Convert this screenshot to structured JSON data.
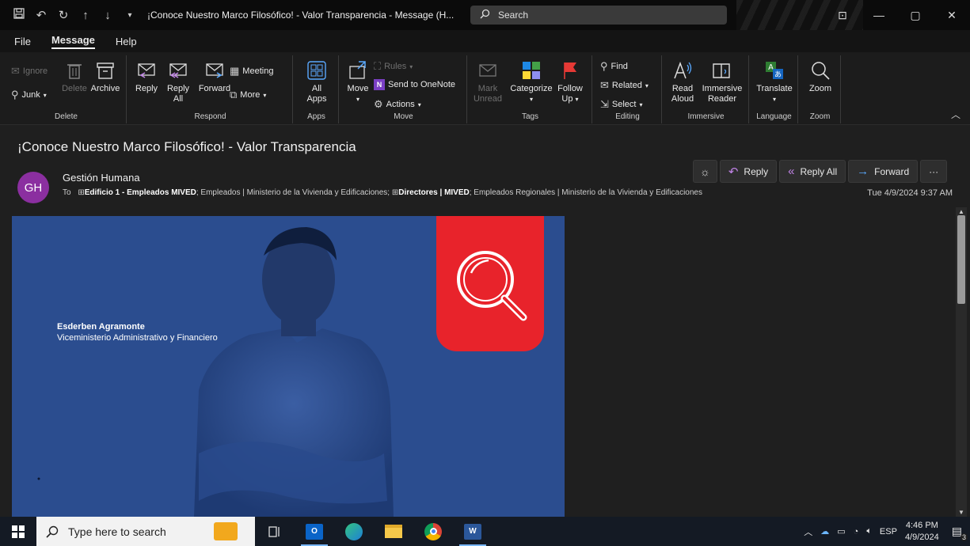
{
  "titlebar": {
    "title": "¡Conoce Nuestro Marco Filosófico! - Valor Transparencia  -  Message (H...",
    "search_placeholder": "Search"
  },
  "menu": {
    "tabs": [
      "File",
      "Message",
      "Help"
    ],
    "active": "Message"
  },
  "ribbon": {
    "delete_group": {
      "label": "Delete",
      "ignore": "Ignore",
      "junk": "Junk",
      "delete": "Delete",
      "archive": "Archive"
    },
    "respond_group": {
      "label": "Respond",
      "reply": "Reply",
      "reply_all_1": "Reply",
      "reply_all_2": "All",
      "forward": "Forward",
      "meeting": "Meeting",
      "more": "More"
    },
    "apps_group": {
      "label": "Apps",
      "all_apps_1": "All",
      "all_apps_2": "Apps"
    },
    "move_group": {
      "label": "Move",
      "move": "Move",
      "rules": "Rules",
      "onenote": "Send to OneNote",
      "actions": "Actions"
    },
    "tags_group": {
      "label": "Tags",
      "mark_unread_1": "Mark",
      "mark_unread_2": "Unread",
      "categorize": "Categorize",
      "follow_up_1": "Follow",
      "follow_up_2": "Up"
    },
    "editing_group": {
      "label": "Editing",
      "find": "Find",
      "related": "Related",
      "select": "Select"
    },
    "immersive_group": {
      "label": "Immersive",
      "read_aloud_1": "Read",
      "read_aloud_2": "Aloud",
      "immersive_reader_1": "Immersive",
      "immersive_reader_2": "Reader"
    },
    "language_group": {
      "label": "Language",
      "translate": "Translate"
    },
    "zoom_group": {
      "label": "Zoom",
      "zoom": "Zoom"
    }
  },
  "message": {
    "subject": "¡Conoce Nuestro Marco Filosófico! - Valor Transparencia",
    "avatar_initials": "GH",
    "sender": "Gestión Humana",
    "to_label": "To",
    "recipient_1": "Edificio 1 - Empleados MIVED",
    "recipient_2": "; Empleados | Ministerio de la Vivienda y Edificaciones; ",
    "recipient_3": "Directores | MIVED",
    "recipient_4": "; Empleados Regionales | Ministerio de la Vivienda y Edificaciones",
    "date": "Tue 4/9/2024 9:37 AM",
    "actions": {
      "reply": "Reply",
      "reply_all": "Reply All",
      "forward": "Forward",
      "more": "···"
    }
  },
  "banner": {
    "name": "Esderben Agramonte",
    "role": "Viceministerio Administrativo y Financiero",
    "colors": {
      "background": "#2b4d8f",
      "accent": "#e8232b"
    }
  },
  "taskbar": {
    "search_placeholder": "Type here to search",
    "language": "ESP",
    "time": "4:46 PM",
    "date": "4/9/2024",
    "notification_count": "3"
  }
}
